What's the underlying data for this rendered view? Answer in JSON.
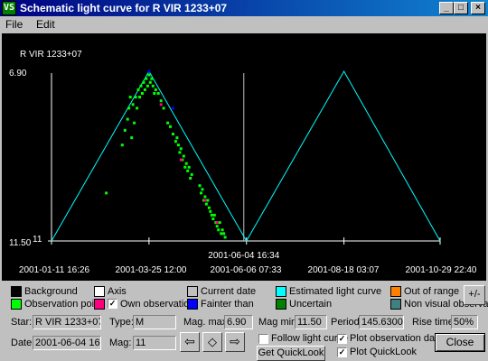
{
  "window": {
    "title": "Schematic light curve for R VIR 1233+07",
    "app_icon": "vsn-app-icon",
    "min_glyph": "_",
    "max_glyph": "□",
    "close_glyph": "×"
  },
  "menu": [
    "File",
    "Edit"
  ],
  "chart": {
    "star_label": "R VIR 1233+07",
    "y_top_label": "6.90",
    "y_bottom_label": "11.50",
    "y_bottom_tick": "11",
    "current_date_label": "2001-06-04 16:34",
    "x_labels": [
      "2001-01-11 16:26",
      "2001-03-25 12:00",
      "2001-06-06 07:33",
      "2001-08-18 03:07",
      "2001-10-29 22:40"
    ],
    "colors": {
      "background": "#000000",
      "axis": "#ffffff",
      "observation": "#00ff00",
      "own_observation": "#ff0080",
      "fainter_than": "#0000ff",
      "estimated_curve": "#00ffff",
      "current_date": "#c0c0c0"
    }
  },
  "chart_data": {
    "type": "line",
    "title": "R VIR 1233+07",
    "xlabel": "",
    "ylabel": "",
    "ylim": [
      11.5,
      6.9
    ],
    "x_ticks": [
      "2001-01-11 16:26",
      "2001-03-25 12:00",
      "2001-06-06 07:33",
      "2001-08-18 03:07",
      "2001-10-29 22:40"
    ],
    "series": [
      {
        "kind": "estimated_curve",
        "x": [
          "2001-01-11",
          "2001-03-25",
          "2001-06-06",
          "2001-08-18",
          "2001-10-29"
        ],
        "y": [
          11.5,
          6.9,
          11.5,
          6.9,
          11.5
        ]
      },
      {
        "kind": "observation",
        "x": [
          "2001-02-21",
          "2001-03-05",
          "2001-03-07",
          "2001-03-09",
          "2001-03-10",
          "2001-03-11",
          "2001-03-12",
          "2001-03-13",
          "2001-03-14",
          "2001-03-15",
          "2001-03-16",
          "2001-03-17",
          "2001-03-18",
          "2001-03-19",
          "2001-03-20",
          "2001-03-21",
          "2001-03-22",
          "2001-03-23",
          "2001-03-24",
          "2001-03-25",
          "2001-03-26",
          "2001-03-27",
          "2001-03-28",
          "2001-03-29",
          "2001-03-30",
          "2001-04-01",
          "2001-04-03",
          "2001-04-05",
          "2001-04-08",
          "2001-04-10",
          "2001-04-12",
          "2001-04-14",
          "2001-04-15",
          "2001-04-16",
          "2001-04-17",
          "2001-04-18",
          "2001-04-19",
          "2001-04-20",
          "2001-04-21",
          "2001-04-22",
          "2001-04-23",
          "2001-04-24",
          "2001-04-25",
          "2001-04-26",
          "2001-05-02",
          "2001-05-03",
          "2001-05-04",
          "2001-05-05",
          "2001-05-06",
          "2001-05-07",
          "2001-05-08",
          "2001-05-09",
          "2001-05-10",
          "2001-05-11",
          "2001-05-12",
          "2001-05-13",
          "2001-05-14",
          "2001-05-15",
          "2001-05-16",
          "2001-05-17",
          "2001-05-18",
          "2001-05-19",
          "2001-05-20",
          "2001-05-21"
        ],
        "y": [
          10.2,
          8.9,
          8.5,
          8.2,
          7.9,
          7.6,
          8.7,
          7.8,
          8.3,
          7.6,
          7.9,
          7.4,
          7.6,
          7.3,
          7.5,
          7.2,
          7.4,
          7.1,
          7.3,
          7.0,
          7.2,
          7.1,
          7.3,
          7.5,
          7.4,
          7.5,
          7.7,
          7.9,
          8.3,
          8.4,
          8.6,
          8.8,
          8.7,
          8.9,
          9.1,
          9.0,
          9.3,
          9.2,
          9.5,
          9.4,
          9.6,
          9.5,
          9.8,
          9.7,
          10.0,
          10.2,
          10.1,
          10.4,
          10.3,
          10.5,
          10.4,
          10.6,
          10.7,
          10.8,
          10.9,
          10.8,
          11.0,
          11.1,
          11.2,
          11.0,
          11.3,
          11.2,
          11.3,
          11.4
        ]
      },
      {
        "kind": "own_observation",
        "x": [
          "2001-04-03",
          "2001-04-18",
          "2001-05-06",
          "2001-05-15"
        ],
        "y": [
          7.8,
          9.3,
          10.4,
          11.0
        ]
      },
      {
        "kind": "fainter_than",
        "x": [
          "2001-03-25",
          "2001-04-12"
        ],
        "y": [
          6.9,
          7.9
        ]
      }
    ]
  },
  "legend": [
    {
      "label": "Background",
      "color": "#000000",
      "checkbox": false
    },
    {
      "label": "Axis",
      "color": "#ffffff",
      "checkbox": false
    },
    {
      "label": "Current date",
      "color": "#c0c0c0",
      "checkbox": false
    },
    {
      "label": "Estimated light curve",
      "color": "#00ffff",
      "checkbox": false
    },
    {
      "label": "Out of range",
      "color": "#ff8000",
      "checkbox": false
    },
    {
      "label": "Observation point",
      "color": "#00ff00",
      "checkbox": false
    },
    {
      "label": "Own observation",
      "color": "#ff0080",
      "checkbox": true
    },
    {
      "label": "Fainter than",
      "color": "#0000ff",
      "checkbox": false
    },
    {
      "label": "Uncertain",
      "color": "#008000",
      "checkbox": false
    },
    {
      "label": "Non visual observation",
      "color": "#408080",
      "checkbox": false
    }
  ],
  "plusminus_label": "+/-",
  "form": {
    "star_label": "Star:",
    "star_value": "R VIR 1233+07",
    "type_label": "Type:",
    "type_value": "M",
    "magmax_label": "Mag. max:",
    "magmax_value": "6.90",
    "magmin_label": "Mag min:",
    "magmin_value": "11.50",
    "period_label": "Period:",
    "period_value": "145.6300",
    "rise_label": "Rise time:",
    "rise_value": "50%",
    "date_label": "Date:",
    "date_value": "2001-06-04 16:34",
    "mag_label": "Mag:",
    "mag_value": "11",
    "prev_glyph": "⇦",
    "center_glyph": "◇",
    "next_glyph": "⇨",
    "follow_label": "Follow light curve",
    "follow_checked": false,
    "plot_obs_label": "Plot observation data",
    "plot_obs_checked": true,
    "plot_ql_label": "Plot QuickLook",
    "plot_ql_checked": true,
    "get_ql_label": "Get QuickLook",
    "close_label": "Close",
    "check_glyph": "✓"
  }
}
